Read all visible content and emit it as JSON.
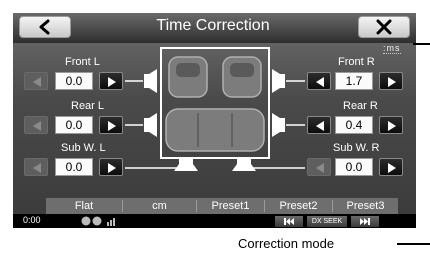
{
  "title": "Time Correction",
  "icons": {
    "back": "chevron-left-icon",
    "close": "close-icon"
  },
  "unit_label": ":ms",
  "channels": {
    "front_l": {
      "label": "Front L",
      "value": "0.0"
    },
    "front_r": {
      "label": "Front R",
      "value": "1.7"
    },
    "rear_l": {
      "label": "Rear L",
      "value": "0.0"
    },
    "rear_r": {
      "label": "Rear R",
      "value": "0.4"
    },
    "sub_l": {
      "label": "Sub W. L",
      "value": "0.0"
    },
    "sub_r": {
      "label": "Sub W. R",
      "value": "0.0"
    }
  },
  "presets": {
    "flat": "Flat",
    "cm": "cm",
    "preset1": "Preset1",
    "preset2": "Preset2",
    "preset3": "Preset3"
  },
  "status": {
    "time": "0:00",
    "dx_seek": "DX SEEK"
  },
  "annotation": {
    "caption": "Correction mode"
  }
}
